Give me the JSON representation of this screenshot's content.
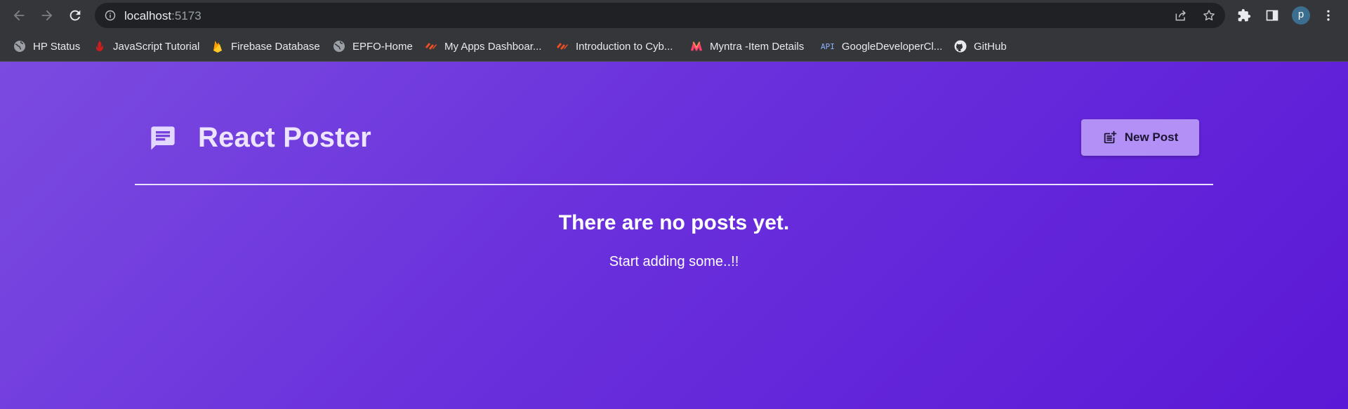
{
  "browser": {
    "url_host": "localhost",
    "url_port": ":5173",
    "avatar_letter": "p",
    "bookmarks": [
      {
        "label": "HP Status",
        "icon": "globe-icon"
      },
      {
        "label": "JavaScript Tutorial",
        "icon": "js-tutorial-icon"
      },
      {
        "label": "Firebase Database",
        "icon": "firebase-icon"
      },
      {
        "label": "EPFO-Home",
        "icon": "globe-icon"
      },
      {
        "label": "My Apps Dashboar...",
        "icon": "apps-dashboard-icon"
      },
      {
        "label": "Introduction to Cyb...",
        "icon": "cyber-course-icon"
      },
      {
        "label": "Myntra -Item Details",
        "icon": "myntra-icon"
      },
      {
        "label": "GoogleDeveloperCl...",
        "icon": "api-icon",
        "icon_text": "API"
      },
      {
        "label": "GitHub",
        "icon": "github-icon"
      }
    ]
  },
  "app": {
    "title": "React Poster",
    "new_post_label": "New Post",
    "empty_title": "There are no posts yet.",
    "empty_subtitle": "Start adding some..!!"
  },
  "colors": {
    "page_gradient_start": "#7b4be0",
    "page_gradient_end": "#5b18d6",
    "button_bg": "#b290f5",
    "title_color": "#ede5ff"
  }
}
